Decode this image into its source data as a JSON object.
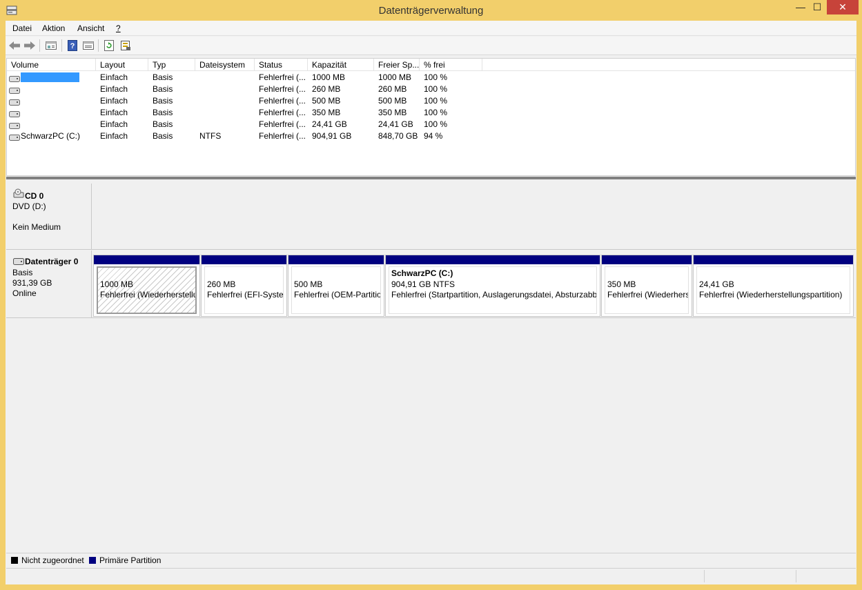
{
  "window": {
    "title": "Datenträgerverwaltung",
    "minimize_glyph": "—",
    "maximize_glyph": "☐",
    "close_glyph": "✕"
  },
  "menu": {
    "items": [
      {
        "label": "Datei"
      },
      {
        "label": "Aktion"
      },
      {
        "label": "Ansicht"
      },
      {
        "label": "?"
      }
    ]
  },
  "toolbar": {
    "buttons": [
      "back-icon",
      "forward-icon",
      "disk-list-icon",
      "help-icon",
      "properties-icon",
      "refresh-icon",
      "rescan-disks-icon"
    ]
  },
  "volume_list": {
    "columns": [
      "Volume",
      "Layout",
      "Typ",
      "Dateisystem",
      "Status",
      "Kapazität",
      "Freier Sp...",
      "% frei"
    ],
    "rows": [
      {
        "volume": "",
        "layout": "Einfach",
        "typ": "Basis",
        "dateisystem": "",
        "status": "Fehlerfrei (...",
        "kapazitaet": "1000 MB",
        "frei": "1000 MB",
        "prozent": "100 %",
        "selected": true
      },
      {
        "volume": "",
        "layout": "Einfach",
        "typ": "Basis",
        "dateisystem": "",
        "status": "Fehlerfrei (...",
        "kapazitaet": "260 MB",
        "frei": "260 MB",
        "prozent": "100 %"
      },
      {
        "volume": "",
        "layout": "Einfach",
        "typ": "Basis",
        "dateisystem": "",
        "status": "Fehlerfrei (...",
        "kapazitaet": "500 MB",
        "frei": "500 MB",
        "prozent": "100 %"
      },
      {
        "volume": "",
        "layout": "Einfach",
        "typ": "Basis",
        "dateisystem": "",
        "status": "Fehlerfrei (...",
        "kapazitaet": "350 MB",
        "frei": "350 MB",
        "prozent": "100 %"
      },
      {
        "volume": "",
        "layout": "Einfach",
        "typ": "Basis",
        "dateisystem": "",
        "status": "Fehlerfrei (...",
        "kapazitaet": "24,41 GB",
        "frei": "24,41 GB",
        "prozent": "100 %"
      },
      {
        "volume": "SchwarzPC (C:)",
        "layout": "Einfach",
        "typ": "Basis",
        "dateisystem": "NTFS",
        "status": "Fehlerfrei (...",
        "kapazitaet": "904,91 GB",
        "frei": "848,70 GB",
        "prozent": "94 %"
      }
    ]
  },
  "disks": {
    "cd": {
      "name": "CD 0",
      "type": "DVD (D:)",
      "media": "Kein Medium"
    },
    "disk0": {
      "name": "Datenträger 0",
      "type": "Basis",
      "size": "931,39 GB",
      "state": "Online",
      "partitions": [
        {
          "title": "",
          "size": "1000 MB",
          "status": "Fehlerfrei (Wiederherstellungspartition)",
          "selected": true
        },
        {
          "title": "",
          "size": "260 MB",
          "status": "Fehlerfrei (EFI-Systempartition)"
        },
        {
          "title": "",
          "size": "500 MB",
          "status": "Fehlerfrei (OEM-Partition)"
        },
        {
          "title": "SchwarzPC  (C:)",
          "size": "904,91 GB NTFS",
          "status": "Fehlerfrei (Startpartition, Auslagerungsdatei, Absturzabbild, Primäre Partition)"
        },
        {
          "title": "",
          "size": "350 MB",
          "status": "Fehlerfrei (Wiederherstellungspartition)"
        },
        {
          "title": "",
          "size": "24,41 GB",
          "status": "Fehlerfrei (Wiederherstellungspartition)"
        }
      ]
    }
  },
  "legend": {
    "items": [
      {
        "label": "Nicht zugeordnet",
        "color": "#000000"
      },
      {
        "label": "Primäre Partition",
        "color": "#000080"
      }
    ]
  },
  "colors": {
    "title_bar": "#f2cf6b",
    "selection": "#3399ff",
    "partition_bar": "#000080",
    "close_button": "#c7433a"
  }
}
